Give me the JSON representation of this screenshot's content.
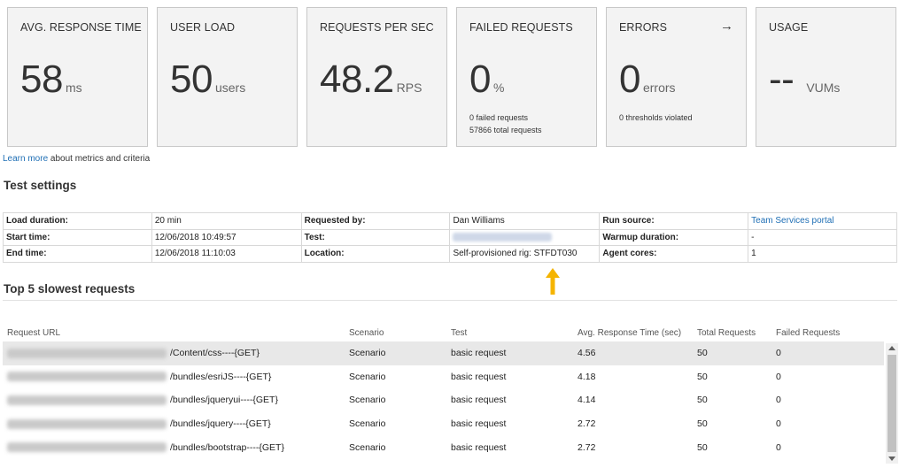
{
  "tiles": [
    {
      "title": "AVG. RESPONSE TIME",
      "value": "58",
      "unit": "ms"
    },
    {
      "title": "USER LOAD",
      "value": "50",
      "unit": "users"
    },
    {
      "title": "REQUESTS PER SEC",
      "value": "48.2",
      "unit": "RPS"
    },
    {
      "title": "FAILED REQUESTS",
      "value": "0",
      "unit": "%",
      "sub1": "0 failed requests",
      "sub2": "57866 total requests"
    },
    {
      "title": "ERRORS",
      "value": "0",
      "unit": "errors",
      "sub1": "0 thresholds violated"
    },
    {
      "title": "USAGE",
      "value": "--",
      "unit": "VUMs"
    }
  ],
  "learn_more": {
    "link": "Learn more",
    "text": " about metrics and criteria"
  },
  "test_settings": {
    "title": "Test settings",
    "rows": [
      [
        "Load duration:",
        "20 min",
        "Requested by:",
        "Dan Williams",
        "Run source:",
        "Team Services portal"
      ],
      [
        "Start time:",
        "12/06/2018 10:49:57",
        "Test:",
        "",
        "Warmup duration:",
        "-"
      ],
      [
        "End time:",
        "12/06/2018 11:10:03",
        "Location:",
        "Self-provisioned rig: STFDT030",
        "Agent cores:",
        "1"
      ]
    ]
  },
  "slowest": {
    "title": "Top 5 slowest requests",
    "headers": [
      "Request URL",
      "Scenario",
      "Test",
      "Avg. Response Time (sec)",
      "Total Requests",
      "Failed Requests"
    ],
    "rows": [
      [
        "/Content/css----{GET}",
        "Scenario",
        "basic request",
        "4.56",
        "50",
        "0"
      ],
      [
        "/bundles/esriJS----{GET}",
        "Scenario",
        "basic request",
        "4.18",
        "50",
        "0"
      ],
      [
        "/bundles/jqueryui----{GET}",
        "Scenario",
        "basic request",
        "4.14",
        "50",
        "0"
      ],
      [
        "/bundles/jquery----{GET}",
        "Scenario",
        "basic request",
        "2.72",
        "50",
        "0"
      ],
      [
        "/bundles/bootstrap----{GET}",
        "Scenario",
        "basic request",
        "2.72",
        "50",
        "0"
      ]
    ]
  },
  "colors": {
    "link": "#1f6fb5",
    "arrow": "#f5b400",
    "tile_bg": "#f3f3f3",
    "selected_row": "#e8e8e8"
  }
}
